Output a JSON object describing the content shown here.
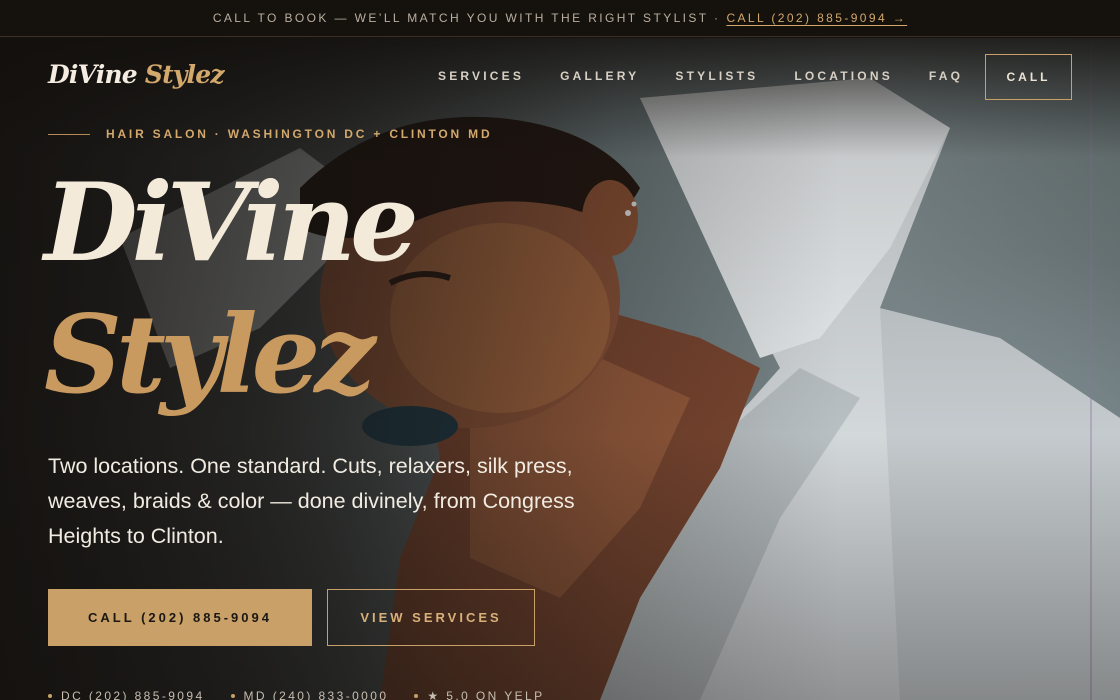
{
  "topbar": {
    "message": "CALL TO BOOK — WE’LL MATCH YOU WITH THE RIGHT STYLIST ·",
    "cta": "CALL (202) 885-9094 →"
  },
  "brand": {
    "word1": "DiVine",
    "word2": "Stylez"
  },
  "nav": {
    "items": [
      "SERVICES",
      "GALLERY",
      "STYLISTS",
      "LOCATIONS",
      "FAQ"
    ],
    "call": "CALL"
  },
  "hero": {
    "eyebrow": "HAIR SALON · WASHINGTON DC + CLINTON MD",
    "title_line1": "DiVine",
    "title_line2": "Stylez",
    "lede": "Two locations. One standard. Cuts, relaxers, silk press, weaves, braids & color — done divinely, from Congress Heights to Clinton.",
    "primary_button": "CALL (202) 885-9094",
    "secondary_button": "VIEW SERVICES",
    "meta": [
      "DC (202) 885-9094",
      "MD (240) 833-0000",
      "★ 5.0 ON YELP"
    ]
  },
  "colors": {
    "accent_gold": "#c9a067",
    "dark": "#151210",
    "cream": "#f3ead9"
  }
}
